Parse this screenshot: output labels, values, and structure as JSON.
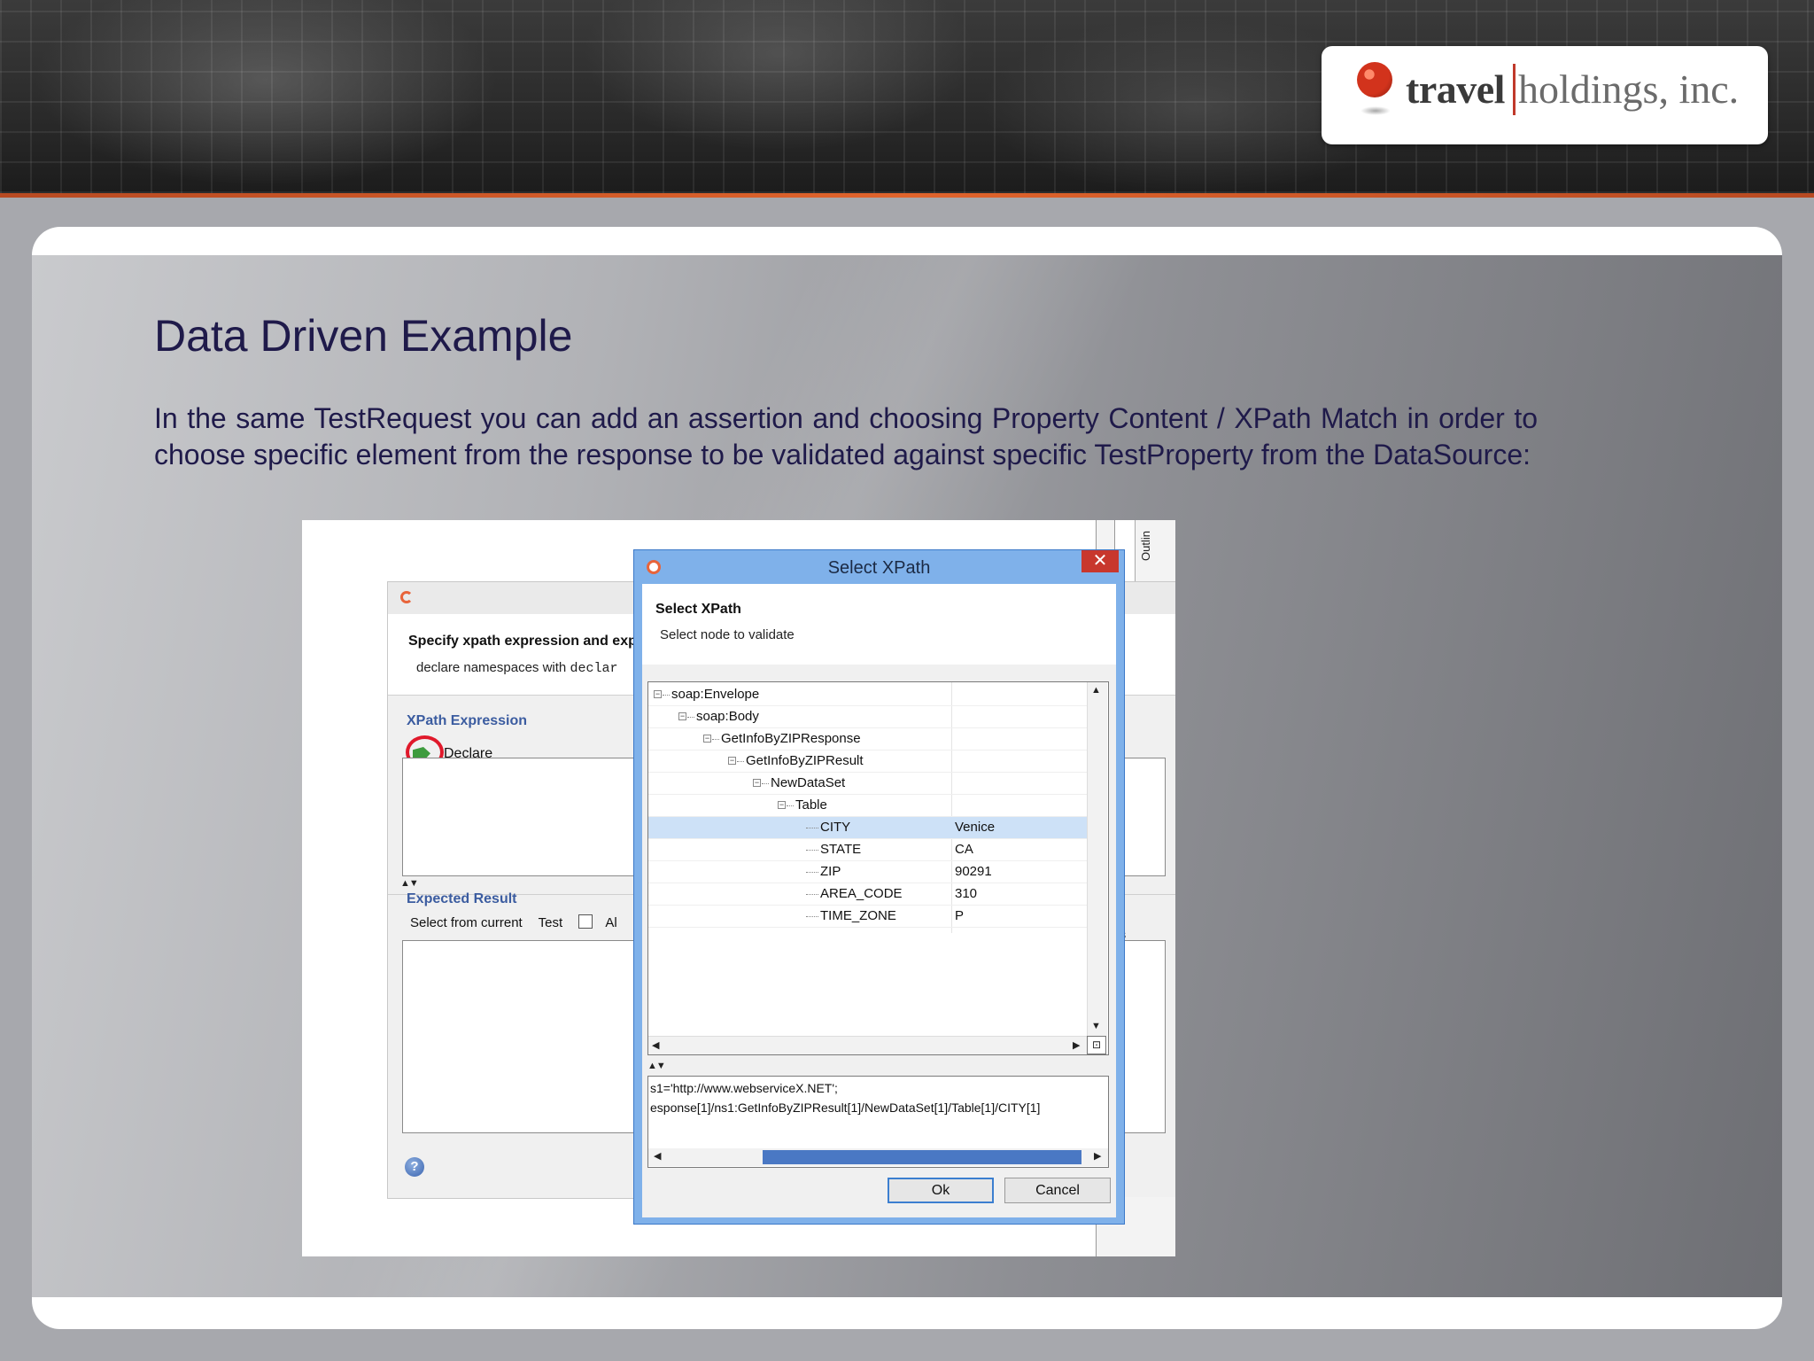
{
  "logo": {
    "brand_bold": "travel",
    "brand_light": "holdings, inc."
  },
  "slide": {
    "title": "Data Driven Example",
    "body": "In the same TestRequest you can add an assertion and choosing Property Content / XPath Match in order to choose specific element from the response to be validated against specific TestProperty from the DataSource:"
  },
  "back_dialog": {
    "header_title": "Specify xpath expression and exp",
    "header_sub_prefix": "declare namespaces with ",
    "header_sub_code": "declar",
    "xpath_section": "XPath Expression",
    "declare_label": "Declare",
    "splitter": "▲▼",
    "expected_section": "Expected Result",
    "select_from_current": "Select from current",
    "test": "Test",
    "all_checkbox_label": "Al",
    "help": "?",
    "outline_tab": "Outlin",
    "right_stub": "ts"
  },
  "xpath_dialog": {
    "title": "Select XPath",
    "close": "✕",
    "header_title": "Select XPath",
    "header_sub": "Select node to validate",
    "tree": [
      {
        "name": "soap:Envelope",
        "depth": 0,
        "toggle": "⊟",
        "value": ""
      },
      {
        "name": "soap:Body",
        "depth": 1,
        "toggle": "⊟",
        "value": ""
      },
      {
        "name": "GetInfoByZIPResponse",
        "depth": 2,
        "toggle": "⊟",
        "value": ""
      },
      {
        "name": "GetInfoByZIPResult",
        "depth": 3,
        "toggle": "⊟",
        "value": ""
      },
      {
        "name": "NewDataSet",
        "depth": 4,
        "toggle": "⊟",
        "value": ""
      },
      {
        "name": "Table",
        "depth": 5,
        "toggle": "⊟",
        "value": ""
      },
      {
        "name": "CITY",
        "depth": 6,
        "toggle": "",
        "value": "Venice",
        "selected": true
      },
      {
        "name": "STATE",
        "depth": 6,
        "toggle": "",
        "value": "CA"
      },
      {
        "name": "ZIP",
        "depth": 6,
        "toggle": "",
        "value": "90291"
      },
      {
        "name": "AREA_CODE",
        "depth": 6,
        "toggle": "",
        "value": "310"
      },
      {
        "name": "TIME_ZONE",
        "depth": 6,
        "toggle": "",
        "value": "P"
      }
    ],
    "splitter": "▲▼",
    "xpath_line1": "s1='http://www.webserviceX.NET';",
    "xpath_line2": "esponse[1]/ns1:GetInfoByZIPResult[1]/NewDataSet[1]/Table[1]/CITY[1]",
    "ok": "Ok",
    "cancel": "Cancel",
    "scroll_up": "▲",
    "scroll_down": "▼",
    "scroll_left": "◀",
    "scroll_right": "▶",
    "zoom": "⊡"
  },
  "colors": {
    "title_text": "#1f1a4a",
    "accent_stripe": "#e0642c",
    "selection": "#cde1f7",
    "dialog_frame": "#7fb1ea"
  }
}
